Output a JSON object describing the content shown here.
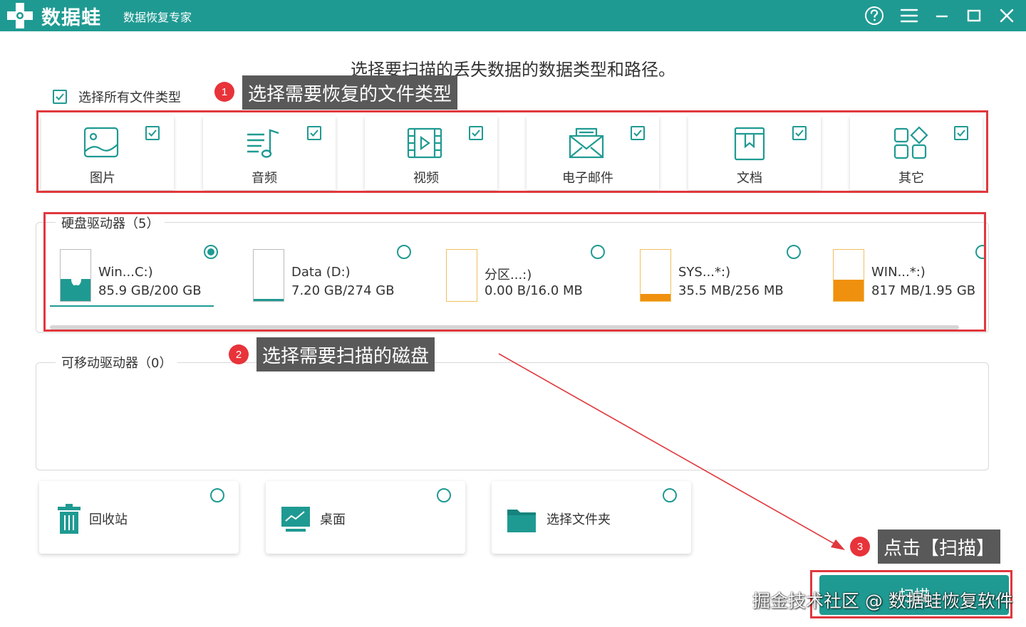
{
  "app": {
    "logo_text": "数据蛙",
    "subtitle": "数据恢复专家",
    "brand_color": "#1f9a92",
    "title_buttons": [
      "help-icon",
      "menu-icon",
      "minimize-icon",
      "maximize-icon",
      "close-icon"
    ]
  },
  "heading": "选择要扫描的丢失数据的数据类型和路径。",
  "select_all": {
    "label": "选择所有文件类型",
    "checked": true
  },
  "file_types": [
    {
      "label": "图片",
      "icon": "image-icon",
      "checked": true
    },
    {
      "label": "音频",
      "icon": "audio-icon",
      "checked": true
    },
    {
      "label": "视频",
      "icon": "video-icon",
      "checked": true
    },
    {
      "label": "电子邮件",
      "icon": "email-icon",
      "checked": true
    },
    {
      "label": "文档",
      "icon": "document-icon",
      "checked": true
    },
    {
      "label": "其它",
      "icon": "other-icon",
      "checked": true
    }
  ],
  "hard_disks": {
    "title": "硬盘驱动器（5）",
    "drives": [
      {
        "name": "Win...C:)",
        "size": "85.9 GB/200 GB",
        "used_fraction": 0.43,
        "fill_color": "#1f9a92",
        "selected": true,
        "system": true
      },
      {
        "name": "Data (D:)",
        "size": "7.20 GB/274 GB",
        "used_fraction": 0.03,
        "fill_color": "#1f9a92",
        "selected": false,
        "system": false
      },
      {
        "name": "分区...:)",
        "size": "0.00  B/16.0 MB",
        "used_fraction": 0.0,
        "fill_color": "#f0900f",
        "selected": false,
        "system": false
      },
      {
        "name": "SYS...*:)",
        "size": "35.5 MB/256 MB",
        "used_fraction": 0.14,
        "fill_color": "#f0900f",
        "selected": false,
        "system": false
      },
      {
        "name": "WIN...*:)",
        "size": "817 MB/1.95 GB",
        "used_fraction": 0.42,
        "fill_color": "#f0900f",
        "selected": false,
        "system": false
      }
    ]
  },
  "removable": {
    "title": "可移动驱动器（0）"
  },
  "locations": [
    {
      "label": "回收站",
      "icon": "recycle-bin-icon",
      "selected": false
    },
    {
      "label": "桌面",
      "icon": "desktop-icon",
      "selected": false
    },
    {
      "label": "选择文件夹",
      "icon": "folder-icon",
      "selected": false
    }
  ],
  "callouts": [
    {
      "num": "1",
      "text": "选择需要恢复的文件类型"
    },
    {
      "num": "2",
      "text": "选择需要扫描的磁盘"
    },
    {
      "num": "3",
      "text": "点击【扫描】"
    }
  ],
  "scan_button": "扫描",
  "watermark": "掘金技术社区 @ 数据蛙恢复软件"
}
